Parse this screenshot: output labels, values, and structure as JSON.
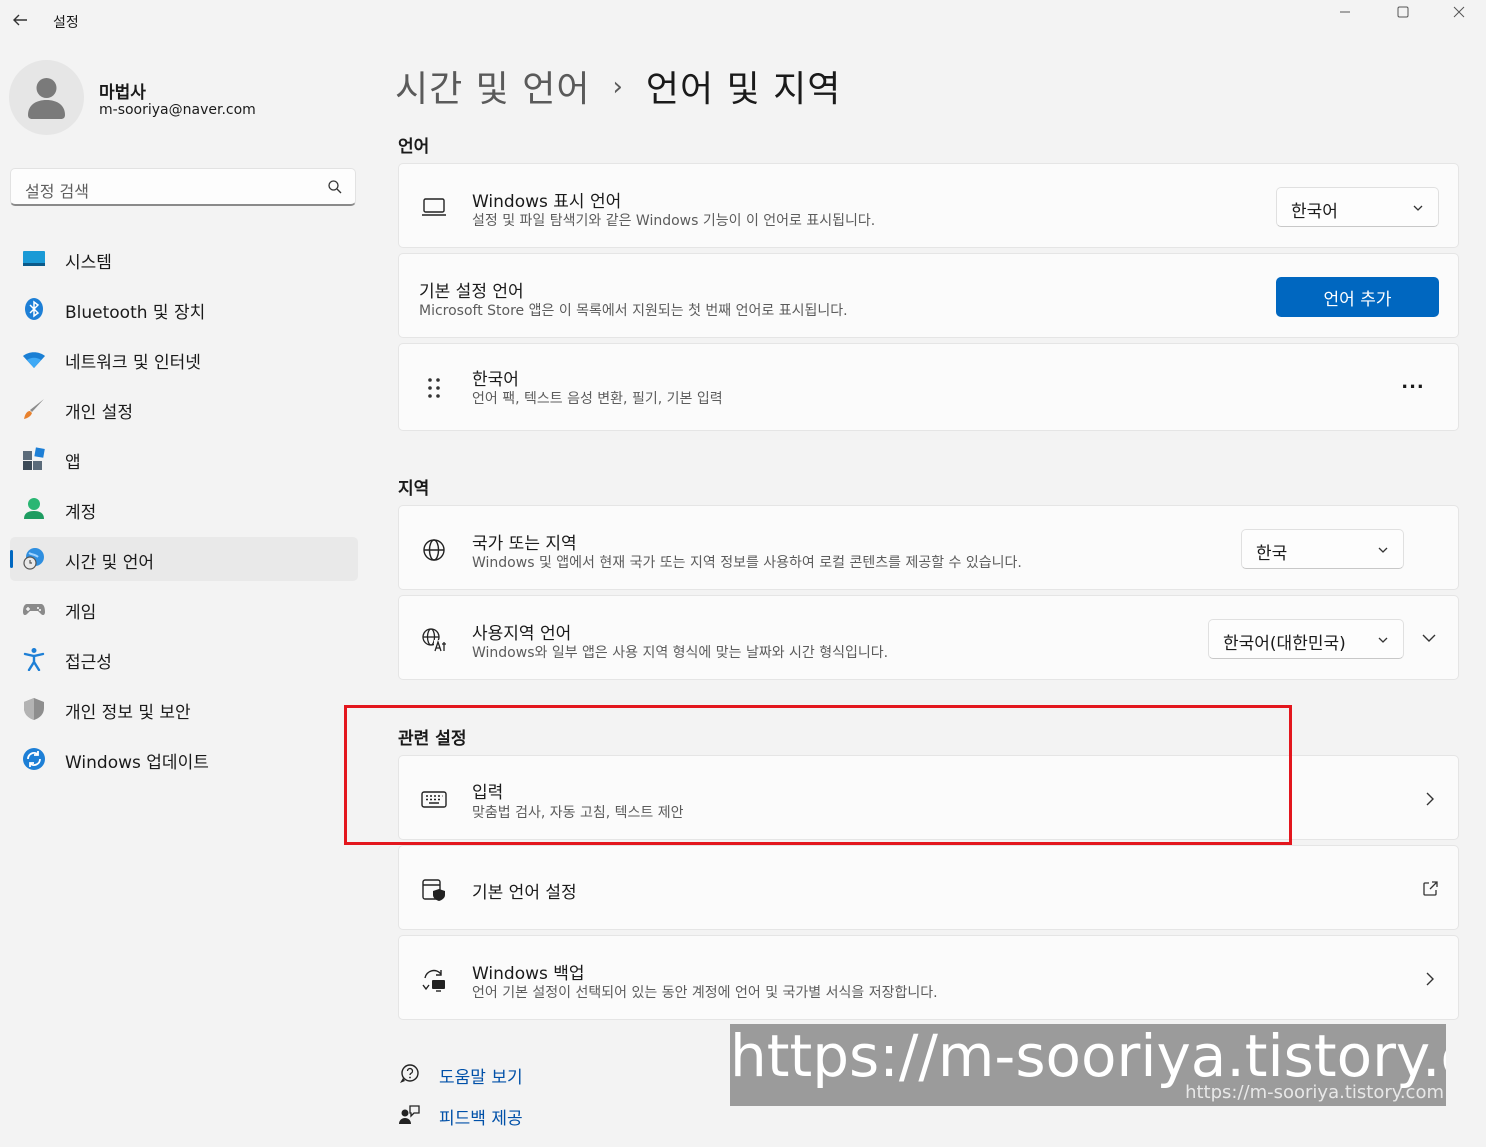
{
  "window": {
    "title": "설정",
    "controls": [
      "minimize-icon",
      "maximize-icon",
      "close-icon"
    ]
  },
  "profile": {
    "name": "마법사",
    "email": "m-sooriya@naver.com"
  },
  "search": {
    "placeholder": "설정 검색"
  },
  "nav": {
    "items": [
      {
        "label": "시스템",
        "icon": "system-icon"
      },
      {
        "label": "Bluetooth 및 장치",
        "icon": "bluetooth-icon"
      },
      {
        "label": "네트워크 및 인터넷",
        "icon": "wifi-icon"
      },
      {
        "label": "개인 설정",
        "icon": "brush-icon"
      },
      {
        "label": "앱",
        "icon": "apps-icon"
      },
      {
        "label": "계정",
        "icon": "account-icon"
      },
      {
        "label": "시간 및 언어",
        "icon": "time-language-icon",
        "selected": true
      },
      {
        "label": "게임",
        "icon": "gamepad-icon"
      },
      {
        "label": "접근성",
        "icon": "accessibility-icon"
      },
      {
        "label": "개인 정보 및 보안",
        "icon": "shield-icon"
      },
      {
        "label": "Windows 업데이트",
        "icon": "update-icon"
      }
    ]
  },
  "breadcrumb": {
    "parent": "시간 및 언어",
    "separator": "›",
    "current": "언어 및 지역"
  },
  "language": {
    "section_title": "언어",
    "display": {
      "title": "Windows 표시 언어",
      "desc": "설정 및 파일 탐색기와 같은 Windows 기능이 이 언어로 표시됩니다.",
      "value": "한국어"
    },
    "preferred": {
      "title": "기본 설정 언어",
      "desc": "Microsoft Store 앱은 이 목록에서 지원되는 첫 번째 언어로 표시됩니다.",
      "button": "언어 추가"
    },
    "korean": {
      "title": "한국어",
      "desc": "언어 팩, 텍스트 음성 변환, 필기, 기본 입력",
      "more": "..."
    }
  },
  "region": {
    "section_title": "지역",
    "country": {
      "title": "국가 또는 지역",
      "desc": "Windows 및 앱에서 현재 국가 또는 지역 정보를 사용하여 로컬 콘텐츠를 제공할 수 있습니다.",
      "value": "한국"
    },
    "format": {
      "title": "사용지역 언어",
      "desc": "Windows와 일부 앱은 사용 지역 형식에 맞는 날짜와 시간 형식입니다.",
      "value": "한국어(대한민국)"
    }
  },
  "related": {
    "section_title": "관련 설정",
    "typing": {
      "title": "입력",
      "desc": "맞춤법 검사, 자동 고침, 텍스트 제안"
    },
    "admin": {
      "title": "기본 언어 설정"
    },
    "backup": {
      "title": "Windows 백업",
      "desc": "언어 기본 설정이 선택되어 있는 동안 계정에 언어 및 국가별 서식을 저장합니다."
    }
  },
  "links": {
    "help": "도움말 보기",
    "feedback": "피드백 제공"
  },
  "watermark": {
    "big": "https://m-sooriya.tistory.com",
    "small": "https://m-sooriya.tistory.com"
  },
  "colors": {
    "accent": "#0067c0",
    "highlight": "#e3161d",
    "background": "#f3f3f3",
    "card": "#fbfbfb"
  }
}
